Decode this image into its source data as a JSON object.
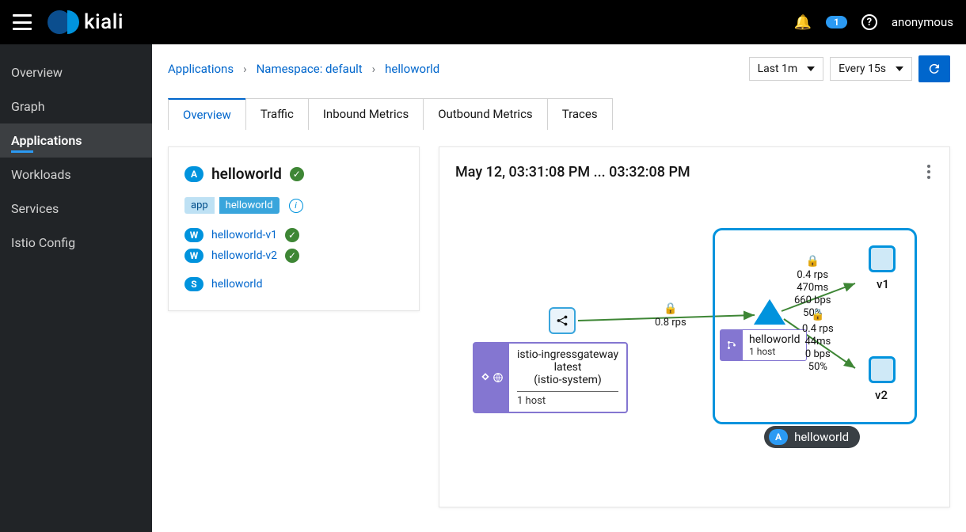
{
  "brand": "kiali",
  "notification_count": "1",
  "user": "anonymous",
  "sidebar": {
    "items": [
      {
        "label": "Overview"
      },
      {
        "label": "Graph"
      },
      {
        "label": "Applications"
      },
      {
        "label": "Workloads"
      },
      {
        "label": "Services"
      },
      {
        "label": "Istio Config"
      }
    ],
    "active_index": 2
  },
  "breadcrumb": {
    "root": "Applications",
    "namespace": "Namespace: default",
    "leaf": "helloworld"
  },
  "toolbar": {
    "duration": "Last 1m",
    "refresh_interval": "Every 15s"
  },
  "tabs": [
    "Overview",
    "Traffic",
    "Inbound Metrics",
    "Outbound Metrics",
    "Traces"
  ],
  "active_tab": 0,
  "details": {
    "app_badge": "A",
    "app_name": "helloworld",
    "label_key": "app",
    "label_value": "helloworld",
    "workloads": [
      {
        "badge": "W",
        "name": "helloworld-v1",
        "healthy": true
      },
      {
        "badge": "W",
        "name": "helloworld-v2",
        "healthy": true
      }
    ],
    "services": [
      {
        "badge": "S",
        "name": "helloworld"
      }
    ]
  },
  "graph": {
    "time_range": "May 12, 03:31:08 PM ... 03:32:08 PM",
    "gateway": {
      "title": "istio-ingressgateway",
      "version": "latest",
      "namespace": "(istio-system)",
      "hosts": "1 host"
    },
    "service": {
      "name": "helloworld",
      "hosts": "1 host"
    },
    "box_label": "helloworld",
    "v1": "v1",
    "v2": "v2",
    "edge_main": "0.8 rps",
    "edge_v1": {
      "rps": "0.4 rps",
      "latency": "470ms",
      "bps": "660 bps",
      "pct": "50%"
    },
    "edge_v2": {
      "rps": "0.4 rps",
      "latency": "44ms",
      "bps": "0 bps",
      "pct": "50%"
    }
  }
}
